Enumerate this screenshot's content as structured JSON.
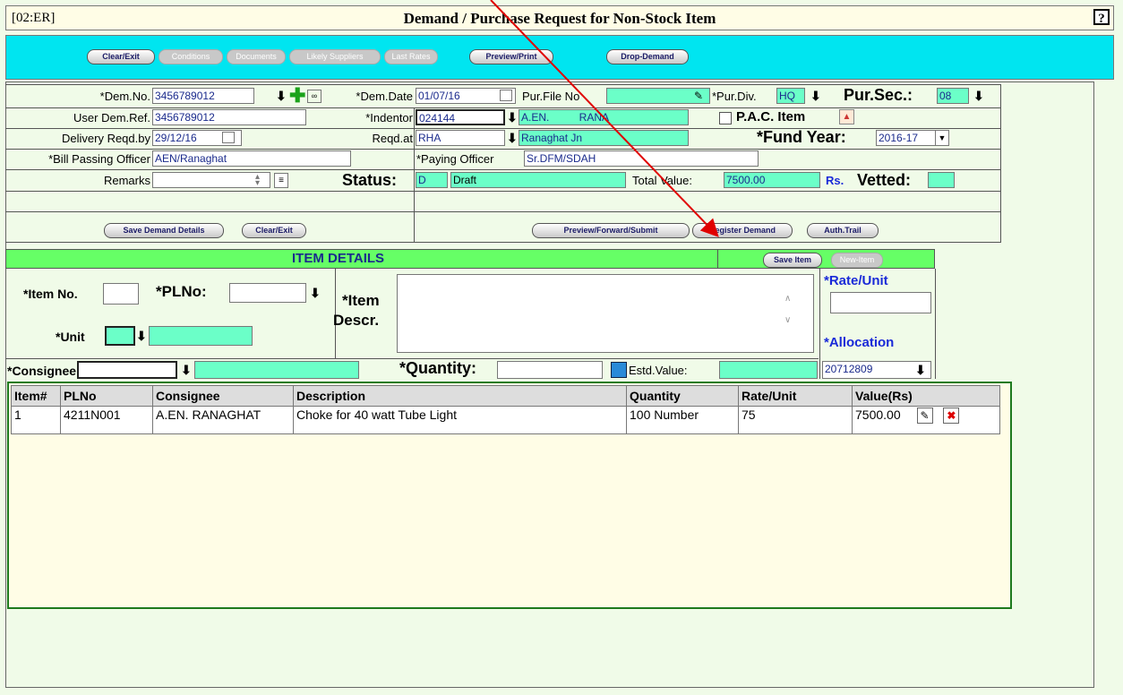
{
  "title_bar": {
    "code": "[02:ER]",
    "title": "Demand / Purchase Request for Non-Stock Item",
    "help": "?"
  },
  "toolbar": {
    "clear_exit": "Clear/Exit",
    "conditions": "Conditions",
    "documents": "Documents",
    "likely_suppliers": "Likely Suppliers",
    "last_rates": "Last Rates",
    "preview_print": "Preview/Print",
    "drop_demand": "Drop-Demand"
  },
  "header": {
    "dem_no_label": "*Dem.No.",
    "dem_no": "3456789012",
    "dem_date_label": "*Dem.Date",
    "dem_date": "01/07/16",
    "pur_file_label": "Pur.File No",
    "pur_file": "",
    "pur_div_label": "*Pur.Div.",
    "pur_div": "HQ",
    "pur_sec_label": "Pur.Sec.:",
    "pur_sec": "08",
    "user_ref_label": "User Dem.Ref.",
    "user_ref": "3456789012",
    "indentor_label": "*Indentor",
    "indentor_code": "024144",
    "indentor_name": "A.EN.          RANA",
    "pac_label": "P.A.C. Item",
    "delivery_label": "Delivery Reqd.by",
    "delivery": "29/12/16",
    "reqd_at_label": "Reqd.at",
    "reqd_at_code": "RHA",
    "reqd_at_name": "Ranaghat Jn",
    "fund_year_label": "*Fund Year:",
    "fund_year": "2016-17",
    "bill_officer_label": "*Bill Passing Officer",
    "bill_officer": "AEN/Ranaghat",
    "paying_officer_label": "*Paying Officer",
    "paying_officer": "Sr.DFM/SDAH",
    "remarks_label": "Remarks",
    "remarks": "",
    "status_label": "Status:",
    "status_code": "D",
    "status_text": "Draft",
    "total_label": "Total Value:",
    "total_value": "7500.00",
    "rs": "Rs.",
    "vetted_label": "Vetted:",
    "vetted": ""
  },
  "actions": {
    "save_demand": "Save Demand Details",
    "clear_exit": "Clear/Exit",
    "preview_forward": "Preview/Forward/Submit",
    "register_demand": "Register Demand",
    "auth_trail": "Auth.Trail"
  },
  "item_details": {
    "heading": "ITEM DETAILS",
    "save_item": "Save Item",
    "new_item": "New-Item",
    "item_no_label": "*Item No.",
    "item_no": "",
    "plno_label": "*PLNo:",
    "plno": "",
    "descr_label_1": "*Item",
    "descr_label_2": "Descr.",
    "descr": "",
    "rate_label": "*Rate/Unit",
    "rate": "",
    "unit_label": "*Unit",
    "unit": "",
    "allocation_label": "*Allocation",
    "allocation": "20712809",
    "consignee_label": "*Consignee",
    "consignee": "",
    "quantity_label": "*Quantity:",
    "quantity": "",
    "estd_label": "Estd.Value:",
    "estd": ""
  },
  "table": {
    "headers": [
      "Item#",
      "PLNo",
      "Consignee",
      "Description",
      "Quantity",
      "Rate/Unit",
      "Value(Rs)"
    ],
    "rows": [
      [
        "1",
        "4211N001",
        "A.EN. RANAGHAT",
        "Choke for 40 watt Tube Light",
        "100 Number",
        "75",
        "7500.00"
      ]
    ]
  },
  "colors": {
    "accent_cyan": "#00e5f0",
    "field_green": "#6bffc8",
    "section_green": "#66ff66",
    "arrow_red": "#e00000"
  }
}
